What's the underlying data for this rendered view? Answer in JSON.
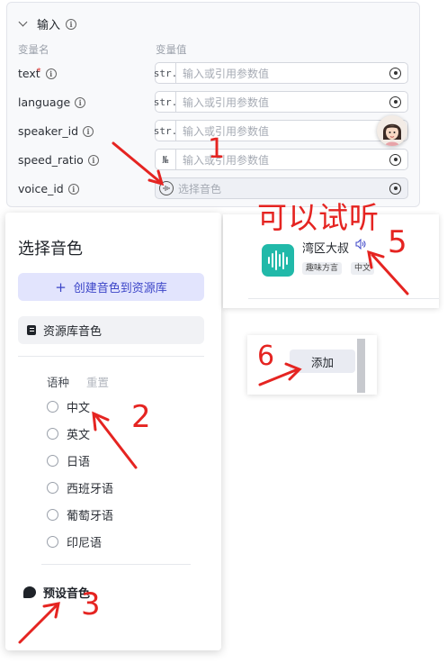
{
  "input_section": {
    "title": "输入",
    "col_name": "变量名",
    "col_value": "变量值",
    "rows": [
      {
        "name": "text",
        "required_mark": "*",
        "type_tag": "str.",
        "placeholder": "输入或引用参数值"
      },
      {
        "name": "language",
        "type_tag": "str.",
        "placeholder": "输入或引用参数值"
      },
      {
        "name": "speaker_id",
        "type_tag": "str.",
        "placeholder": "输入或引用参数值"
      },
      {
        "name": "speed_ratio",
        "type_tag": "№",
        "placeholder": "输入或引用参数值"
      },
      {
        "name": "voice_id",
        "placeholder": "选择音色"
      }
    ],
    "info_glyph": "i"
  },
  "voice_panel": {
    "title": "选择音色",
    "create_button": "创建音色到资源库",
    "create_plus": "+",
    "library_voices": "资源库音色",
    "filter_label": "语种",
    "reset": "重置",
    "languages": [
      "中文",
      "英文",
      "日语",
      "西班牙语",
      "葡萄牙语",
      "印尼语"
    ],
    "preset_voices": "预设音色"
  },
  "voice_card": {
    "name": "湾区大叔",
    "tags": [
      "趣味方言",
      "中文"
    ],
    "speaker_glyph": "🔊"
  },
  "add_panel": {
    "add_button": "添加"
  },
  "annotations": {
    "step1": "1",
    "step2": "2",
    "step3": "3",
    "step5": "5",
    "step6": "6",
    "listen_note": "可以试听",
    "arrow_color": "#e52421"
  },
  "icons": [
    "chevron-down-icon",
    "info-icon",
    "variable-picker-icon",
    "voice-wave-icon",
    "avatar",
    "library-icon",
    "bubble-icon",
    "speaker-icon"
  ]
}
